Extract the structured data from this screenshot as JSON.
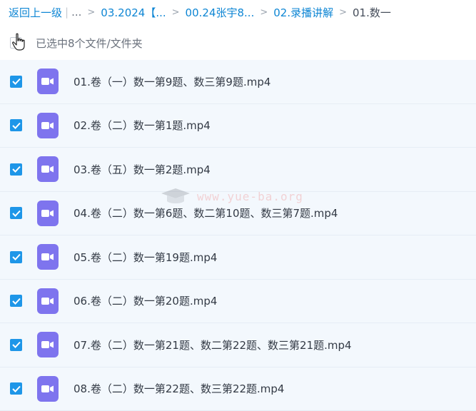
{
  "breadcrumb": {
    "back_label": "返回上一级",
    "separator": "|",
    "ellipsis": "...",
    "arrow": ">",
    "items": [
      "03.2024【...",
      "00.24张宇8...",
      "02.录播讲解"
    ],
    "current": "01.数一"
  },
  "selection": {
    "summary": "已选中8个文件/文件夹"
  },
  "files": [
    {
      "name": "01.卷（一）数一第9题、数三第9题.mp4",
      "checked": true
    },
    {
      "name": "02.卷（二）数一第1题.mp4",
      "checked": true
    },
    {
      "name": "03.卷（五）数一第2题.mp4",
      "checked": true
    },
    {
      "name": "04.卷（二）数一第6题、数二第10题、数三第7题.mp4",
      "checked": true
    },
    {
      "name": "05.卷（二）数一第19题.mp4",
      "checked": true
    },
    {
      "name": "06.卷（二）数一第20题.mp4",
      "checked": true
    },
    {
      "name": "07.卷（二）数一第21题、数二第22题、数三第21题.mp4",
      "checked": true
    },
    {
      "name": "08.卷（二）数一第22题、数三第22题.mp4",
      "checked": true
    }
  ],
  "watermark": {
    "text": "www.yue-ba.org",
    "icon": "graduation-cap-icon"
  },
  "colors": {
    "link": "#0e86d4",
    "checkbox": "#1e96e8",
    "video_icon": "#7e74ee",
    "row_bg": "#f3f8fd"
  }
}
